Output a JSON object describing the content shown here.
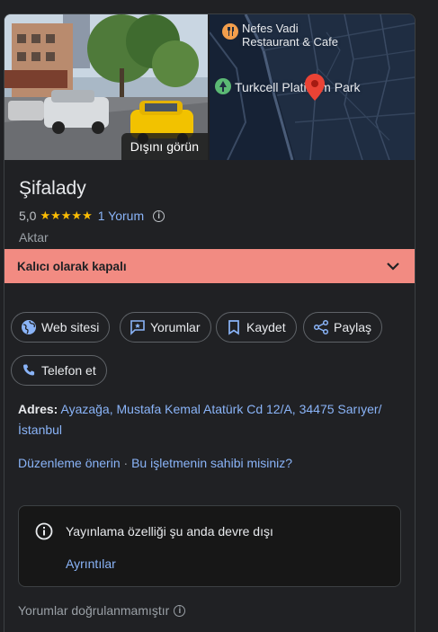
{
  "media": {
    "photo_button_label": "Dışını görün",
    "map_labels": {
      "restaurant_line1": "Nefes Vadi",
      "restaurant_line2": "Restaurant & Cafe",
      "park": "Turkcell Platinum Park"
    }
  },
  "place": {
    "name": "Şifalady",
    "rating": "5,0",
    "stars": "★★★★★",
    "reviews_link": "1 Yorum",
    "category": "Aktar"
  },
  "status": {
    "closed_label": "Kalıcı olarak kapalı"
  },
  "actions": [
    {
      "label": "Web sitesi",
      "icon": "globe-icon"
    },
    {
      "label": "Yorumlar",
      "icon": "review-icon"
    },
    {
      "label": "Kaydet",
      "icon": "bookmark-icon"
    },
    {
      "label": "Paylaş",
      "icon": "share-icon"
    },
    {
      "label": "Telefon et",
      "icon": "phone-icon"
    }
  ],
  "address": {
    "label": "Adres:",
    "value": "Ayazağa, Mustafa Kemal Atatürk Cd 12/A, 34475 Sarıyer/İstanbul"
  },
  "links": {
    "suggest_edit": "Düzenleme önerin",
    "separator": "·",
    "claim_business": "Bu işletmenin sahibi misiniz?"
  },
  "notice": {
    "text": "Yayınlama özelliği şu anda devre dışı",
    "details_link": "Ayrıntılar"
  },
  "footnote": {
    "text": "Yorumlar doğrulanmamıştır"
  },
  "colors": {
    "background": "#202124",
    "closed_banner": "#f28b82",
    "link": "#8ab4f8",
    "star": "#fbbc04",
    "map_pin": "#ea4335"
  }
}
